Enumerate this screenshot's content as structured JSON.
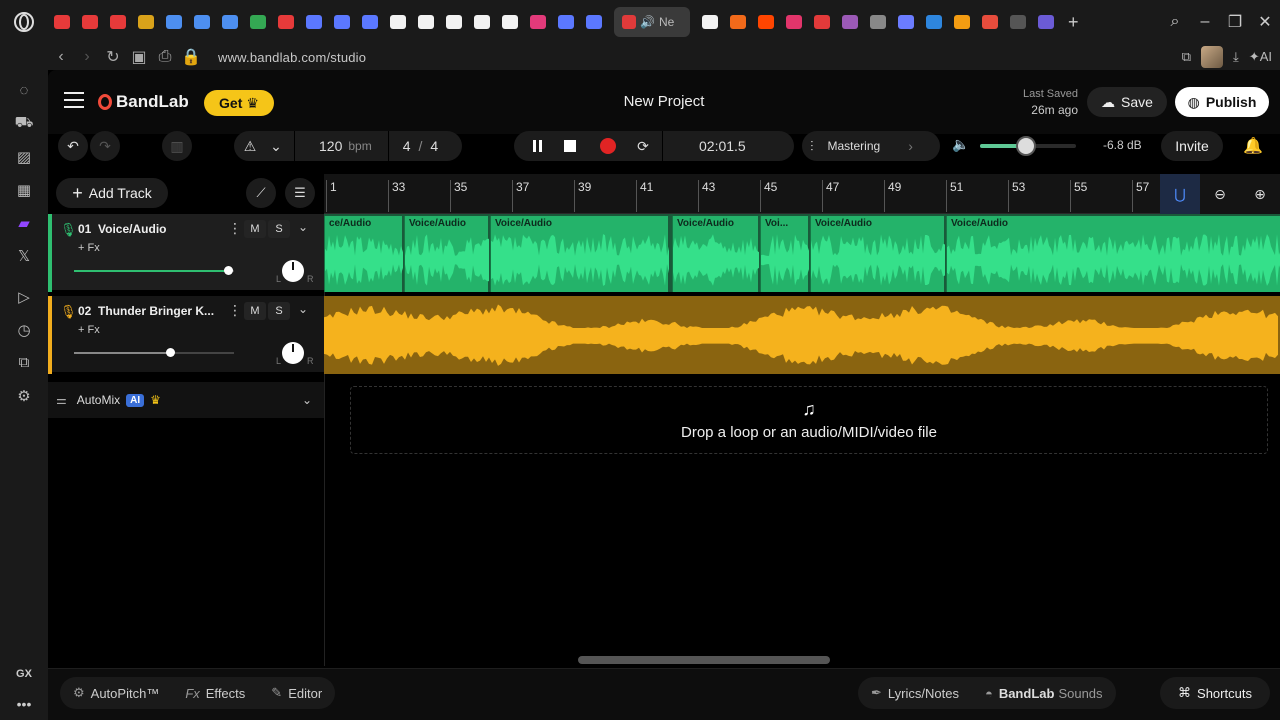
{
  "browser": {
    "active_tab_label": "Ne",
    "url": "www.bandlab.com/studio",
    "ai_label": "AI",
    "gx_label": "GX",
    "favicon_colors": [
      "#e63a3a",
      "#e63a3a",
      "#e63a3a",
      "#d9a21a",
      "#4d8ff0",
      "#4d8ff0",
      "#4d8ff0",
      "#34a853",
      "#e63a3a",
      "#5b78ff",
      "#5b78ff",
      "#5b78ff",
      "#f2f2f2",
      "#f2f2f2",
      "#f2f2f2",
      "#f2f2f2",
      "#f2f2f2",
      "#e23a7a",
      "#5b78ff",
      "#5b78ff"
    ],
    "favicon_colors_after": [
      "#f2f2f2",
      "#f26a1a",
      "#ff4500",
      "#e2356b",
      "#e23a3a",
      "#9b59b6",
      "#888",
      "#6b7cff",
      "#2e86de",
      "#f39c12",
      "#e74c3c",
      "#555",
      "#6b5bd6"
    ]
  },
  "app": {
    "brand": "BandLab",
    "get_label": "Get",
    "project_title": "New Project",
    "last_saved_label": "Last Saved",
    "last_saved_time": "26m ago",
    "save_label": "Save",
    "publish_label": "Publish",
    "invite_label": "Invite"
  },
  "transport": {
    "bpm": "120",
    "bpm_unit": "bpm",
    "time_sig_num": "4",
    "time_sig_sep": "/",
    "time_sig_den": "4",
    "time": "02:01.5",
    "mastering_label": "Mastering",
    "volume_db": "-6.8 dB",
    "volume_level": 0.48
  },
  "tracks_panel": {
    "add_track_label": "Add Track",
    "tracks": [
      {
        "number": "01",
        "name": "Voice/Audio",
        "fx_label": "+ Fx",
        "mute": "M",
        "solo": "S",
        "color": "#2fbf71",
        "volume_fraction": 0.96,
        "pan_l": "L",
        "pan_r": "R"
      },
      {
        "number": "02",
        "name": "Thunder Bringer K...",
        "fx_label": "+ Fx",
        "mute": "M",
        "solo": "S",
        "color": "#f2ad1e",
        "volume_fraction": 0.6,
        "pan_l": "L",
        "pan_r": "R"
      }
    ],
    "automix_label": "AutoMix",
    "ai_badge": "AI"
  },
  "ruler": {
    "bars": [
      "1",
      "33",
      "35",
      "37",
      "39",
      "41",
      "43",
      "45",
      "47",
      "49",
      "51",
      "53",
      "55",
      "57"
    ]
  },
  "clips": {
    "voice": [
      {
        "title": "ce/Audio"
      },
      {
        "title": "Voice/Audio"
      },
      {
        "title": "Voice/Audio"
      },
      {
        "title": "Voice/Audio"
      },
      {
        "title": "Voi..."
      },
      {
        "title": "Voice/Audio"
      },
      {
        "title": "Voice/Audio"
      }
    ]
  },
  "dropzone": {
    "text": "Drop a loop or an audio/MIDI/video file"
  },
  "bottom": {
    "autopitch": "AutoPitch™",
    "effects_icon": "Fx",
    "effects": "Effects",
    "editor": "Editor",
    "lyrics": "Lyrics/Notes",
    "sounds_brand": "BandLab",
    "sounds": "Sounds",
    "shortcuts": "Shortcuts"
  }
}
